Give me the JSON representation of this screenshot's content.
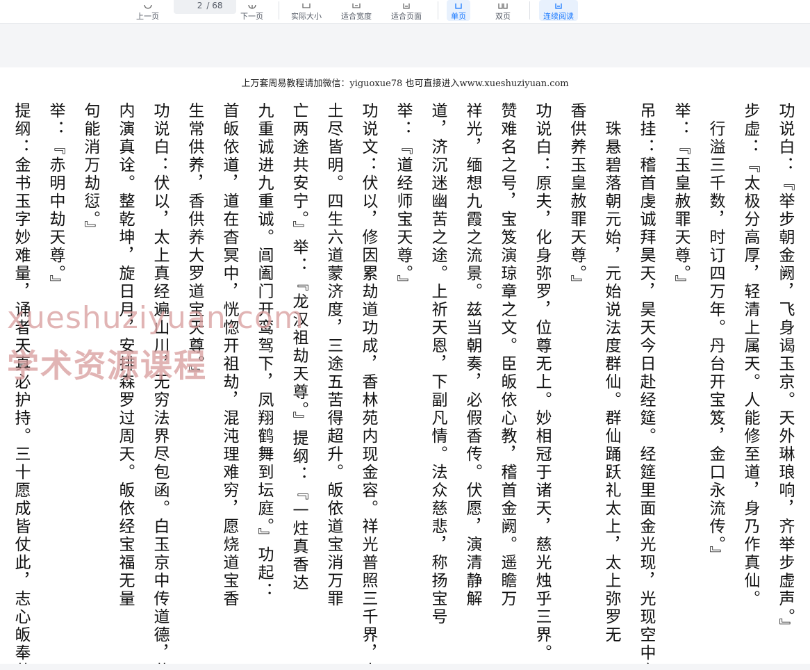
{
  "toolbar": {
    "prev_label": "上一页",
    "page_current": "2",
    "page_total": "/ 68",
    "next_label": "下一页",
    "actual_size_label": "实际大小",
    "fit_width_label": "适合宽度",
    "fit_page_label": "适合页面",
    "single_label": "单页",
    "double_label": "双页",
    "continuous_label": "连续阅读"
  },
  "page": {
    "header": "上万套周易教程请加微信：yiguoxue78  也可直接进入www.xueshuziyuan.com",
    "columns": [
      "功说白：『举步朝金阙，飞身谒玉京。天外琳琅响，齐举步虚声。』",
      "步虚：『太极分高厚，轻清上属天。人能修至道，身乃作真仙。",
      "　行溢三千数，时订四万年。丹台开宝笈，金口永流传。』",
      "举：『玉皇赦罪天尊。』",
      "吊挂：稽首虔诚拜昊天，昊天今日赴经筵。经筵里面金光现，光现空中宝",
      "　珠悬碧落朝元始，元始说法度群仙。群仙踊跃礼太上，太上弥罗无",
      "香供养玉皇赦罪天尊。』",
      "功说白：原夫，化身弥罗，位尊无上。妙相冠于诸天，慈光烛乎三界。玉",
      "赞难名之号，宝笈演琼章之文。臣皈依心教，稽首金阙。遥瞻万",
      "祥光，缅想九霞之流景。兹当朝奏，必假香传。伏愿，演清静解",
      "道，济沉迷幽苦之途。上祈天恩，下副凡情。法众慈悲，称扬宝号",
      "举：『道经师宝天尊。』",
      "功说文：伏以，修因累劫道功成，香林苑内现金容。祥光普照三千界，十",
      "土尽皆明。四生六道蒙济度，三途五苦得超升。皈依道宝消万罪",
      "亡两途共安宁。』举：『龙汉祖劫天尊。』提纲：『一炷真香达",
      "九重诚进九重诚。阊阖门开鸾驾下，凤翔鹤舞到坛庭。』功起：",
      "首皈依道，道在杳冥中，恍惚开祖劫，混沌理难穷，愿烧道宝香",
      "生常供养，香供养大罗道宝天尊。』",
      "功说白：伏以，太上真经遍山川，无穷法界尽包函。白玉京中传道德，黄",
      "内演真诠。整乾坤，旋日月，安排森罗过周天。皈依经宝福无量",
      "句能消万劫愆。』",
      "举：『赤明中劫天尊。』",
      "提纲：金书玉字妙难量，诵者天真必护持。三十愿成皆仗此，志心皈奉莫"
    ]
  },
  "watermark": {
    "line1": "xueshuziyuan.com",
    "line2": "学术资源课程"
  }
}
